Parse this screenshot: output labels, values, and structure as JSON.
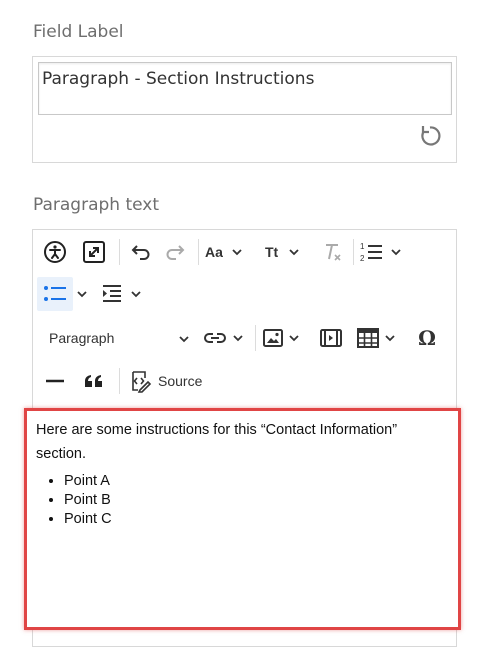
{
  "field_label": {
    "title": "Field Label",
    "value": "Paragraph - Section Instructions",
    "reset_icon": "reset-icon"
  },
  "paragraph": {
    "title": "Paragraph text",
    "toolbar": {
      "heading_select": "Paragraph",
      "source_label": "Source",
      "font_family_label": "Aa",
      "font_size_label": "Tt",
      "buttons": [
        "accessibility-icon",
        "fullscreen-icon",
        "undo-icon",
        "redo-icon",
        "font-family",
        "font-size",
        "remove-format-icon",
        "numbered-list-icon",
        "bulleted-list-icon",
        "indent-icon",
        "link-icon",
        "image-icon",
        "media-icon",
        "table-icon",
        "special-characters-icon",
        "horizontal-line-icon",
        "blockquote-icon",
        "source-icon"
      ]
    },
    "content": {
      "intro": "Here are some instructions for this “Contact Information” section.",
      "points": [
        "Point A",
        "Point B",
        "Point C"
      ]
    }
  },
  "colors": {
    "highlight_border": "#e04545",
    "active_button_bg": "#e9f1fb",
    "accent_blue": "#1a73e8"
  }
}
